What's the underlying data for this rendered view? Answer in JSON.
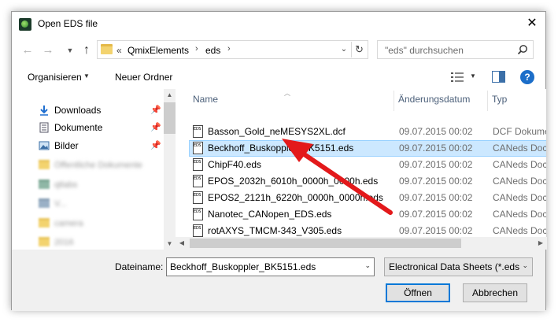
{
  "window": {
    "title": "Open EDS file",
    "close_symbol": "✕"
  },
  "address": {
    "breadcrumb_prefix": "«",
    "breadcrumb": [
      "QmixElements",
      "eds"
    ],
    "separator": "›",
    "search_placeholder": "\"eds\" durchsuchen"
  },
  "toolbar": {
    "organize_label": "Organisieren",
    "new_folder_label": "Neuer Ordner",
    "help_label": "?"
  },
  "nav": {
    "items": [
      {
        "label": "Downloads",
        "icon": "download-arrow-icon"
      },
      {
        "label": "Dokumente",
        "icon": "document-icon"
      },
      {
        "label": "Bilder",
        "icon": "pictures-icon"
      }
    ],
    "blurred_items": [
      "Öffentliche Dokumente",
      "qtlabs",
      "V...",
      "camera",
      "2016",
      "2016"
    ]
  },
  "filelist": {
    "columns": {
      "name": "Name",
      "date": "Änderungsdatum",
      "type": "Typ"
    },
    "rows": [
      {
        "name": "Basson_Gold_neMESYS2XL.dcf",
        "date": "09.07.2015 00:02",
        "type": "DCF Dokument",
        "selected": false
      },
      {
        "name": "Beckhoff_Buskoppler_BK5151.eds",
        "date": "09.07.2015 00:02",
        "type": "CANeds Doc",
        "selected": true
      },
      {
        "name": "ChipF40.eds",
        "date": "09.07.2015 00:02",
        "type": "CANeds Doc",
        "selected": false
      },
      {
        "name": "EPOS_2032h_6010h_0000h_0000h.eds",
        "date": "09.07.2015 00:02",
        "type": "CANeds Doc",
        "selected": false
      },
      {
        "name": "EPOS2_2121h_6220h_0000h_0000h.eds",
        "date": "09.07.2015 00:02",
        "type": "CANeds Doc",
        "selected": false
      },
      {
        "name": "Nanotec_CANopen_EDS.eds",
        "date": "09.07.2015 00:02",
        "type": "CANeds Doc",
        "selected": false
      },
      {
        "name": "rotAXYS_TMCM-343_V305.eds",
        "date": "09.07.2015 00:02",
        "type": "CANeds Doc",
        "selected": false
      }
    ]
  },
  "footer": {
    "filename_label": "Dateiname:",
    "filename_value": "Beckhoff_Buskoppler_BK5151.eds",
    "filter_value": "Electronical Data Sheets (*.eds *",
    "open_label": "Öffnen",
    "cancel_label": "Abbrechen"
  },
  "colors": {
    "selection_bg": "#cce8ff",
    "selection_border": "#99d1ff",
    "accent": "#0078d7",
    "annotation_arrow": "#e3191b"
  }
}
